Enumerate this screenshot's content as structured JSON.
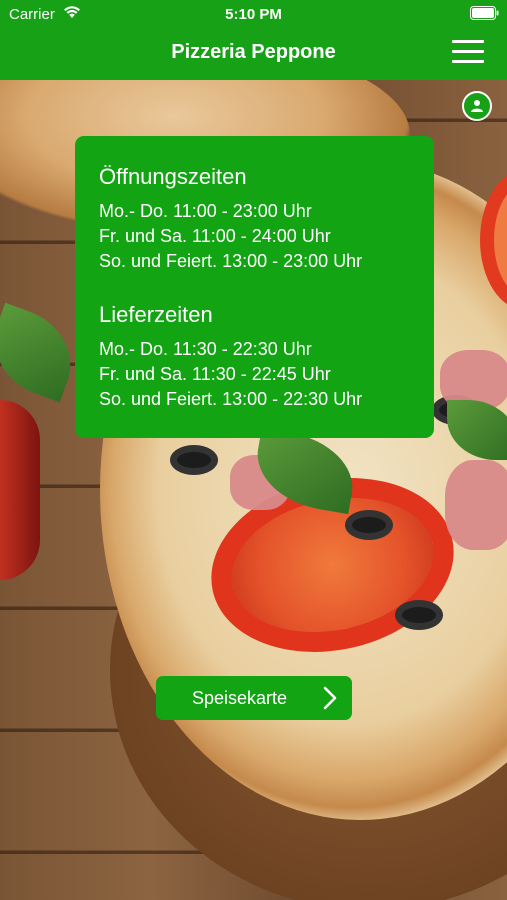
{
  "status_bar": {
    "carrier": "Carrier",
    "time": "5:10 PM"
  },
  "header": {
    "title": "Pizzeria Peppone"
  },
  "icons": {
    "wifi": "wifi-icon",
    "battery": "battery-icon",
    "menu": "hamburger-menu-icon",
    "user": "user-icon",
    "chevron": "chevron-right-icon"
  },
  "opening_hours": {
    "title": "Öffnungszeiten",
    "lines": [
      "Mo.- Do. 11:00 - 23:00 Uhr",
      "Fr. und Sa. 11:00 - 24:00 Uhr",
      "So. und Feiert. 13:00 - 23:00 Uhr"
    ]
  },
  "delivery_hours": {
    "title": "Lieferzeiten",
    "lines": [
      "Mo.- Do. 11:30 - 22:30 Uhr",
      "Fr. und Sa. 11:30 - 22:45 Uhr",
      "So. und Feiert. 13:00 - 22:30 Uhr"
    ]
  },
  "menu_button": {
    "label": "Speisekarte"
  },
  "colors": {
    "brand_green": "#16a116",
    "text": "#ffffff"
  }
}
